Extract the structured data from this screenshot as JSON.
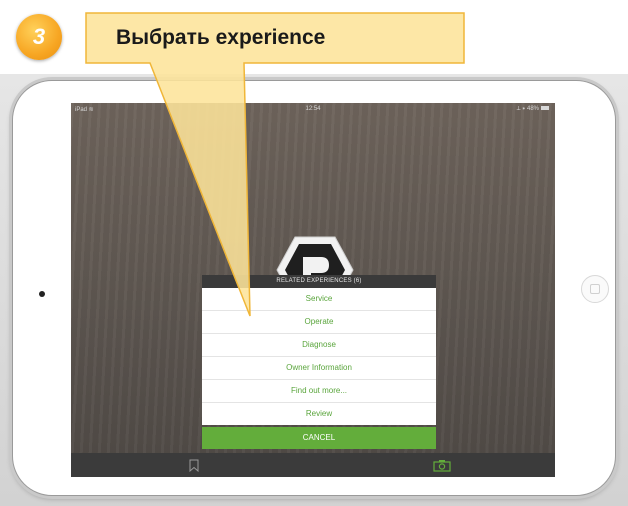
{
  "callout": {
    "step": "3",
    "title": "Выбрать experience"
  },
  "status_bar": {
    "device": "iPad ≋",
    "time": "12:54",
    "battery": "⟂ ∗ 48%"
  },
  "modal": {
    "header": "RELATED EXPERIENCES (6)",
    "items": [
      "Service",
      "Operate",
      "Diagnose",
      "Owner Information",
      "Find out more...",
      "Review"
    ],
    "cancel_label": "CANCEL"
  },
  "bottom_bar": {
    "left_icon": "bookmark-icon",
    "right_icon": "camera-icon"
  },
  "colors": {
    "accent": "#63ad3b",
    "item_text": "#5aa53c",
    "callout_fill": "#fde49a",
    "callout_border": "#f0b638",
    "badge": "#f7a623"
  }
}
